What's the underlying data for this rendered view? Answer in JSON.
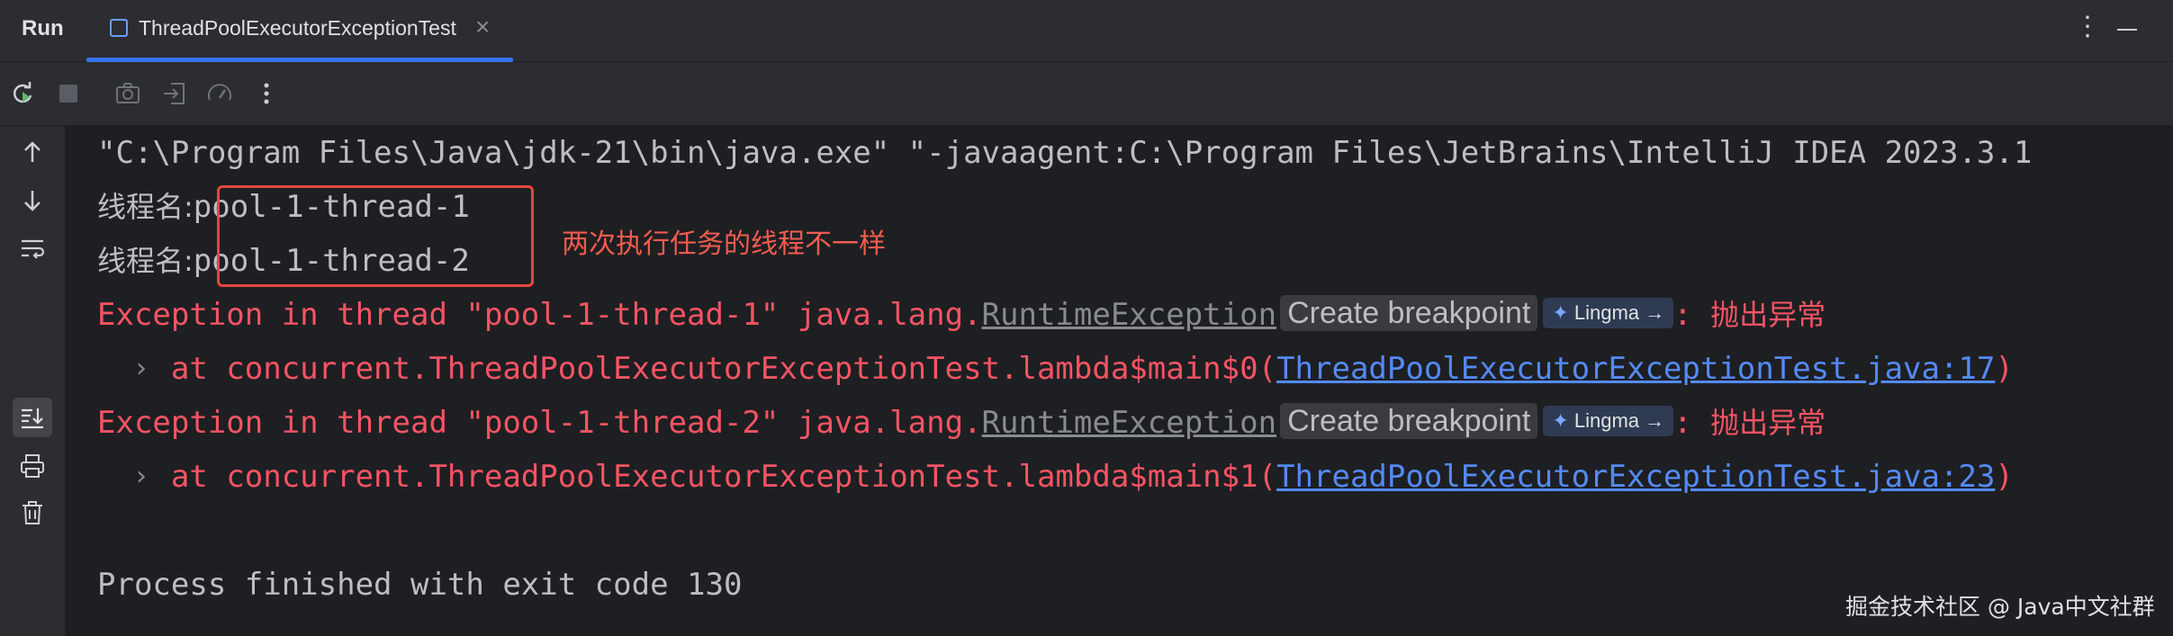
{
  "panel": {
    "title": "Run"
  },
  "tab": {
    "label": "ThreadPoolExecutorExceptionTest",
    "close": "×"
  },
  "console": {
    "command": "\"C:\\Program Files\\Java\\jdk-21\\bin\\java.exe\" \"-javaagent:C:\\Program Files\\JetBrains\\IntelliJ IDEA 2023.3.1",
    "thread_label": "线程名:",
    "thread1": "pool-1-thread-1",
    "thread2": "pool-1-thread-2",
    "exc1_prefix": "Exception in thread \"pool-1-thread-1\" java.lang.",
    "exc2_prefix": "Exception in thread \"pool-1-thread-2\" java.lang.",
    "exc_class": "RuntimeException",
    "create_breakpoint": "Create breakpoint",
    "lingma": "Lingma →",
    "exc_msg_sep": ": ",
    "exc_msg": "抛出异常",
    "at1_prefix": "    at concurrent.ThreadPoolExecutorExceptionTest.lambda$main$0(",
    "at1_link": "ThreadPoolExecutorExceptionTest.java:17",
    "at2_prefix": "    at concurrent.ThreadPoolExecutorExceptionTest.lambda$main$1(",
    "at2_link": "ThreadPoolExecutorExceptionTest.java:23",
    "close_paren": ")",
    "finished": "Process finished with exit code 130"
  },
  "annotation": {
    "text": "两次执行任务的线程不一样"
  },
  "watermark": "掘金技术社区 @ Java中文社群",
  "colors": {
    "accent": "#3574f0",
    "error": "#f75464",
    "link": "#548af7",
    "annotation": "#e3473e"
  }
}
